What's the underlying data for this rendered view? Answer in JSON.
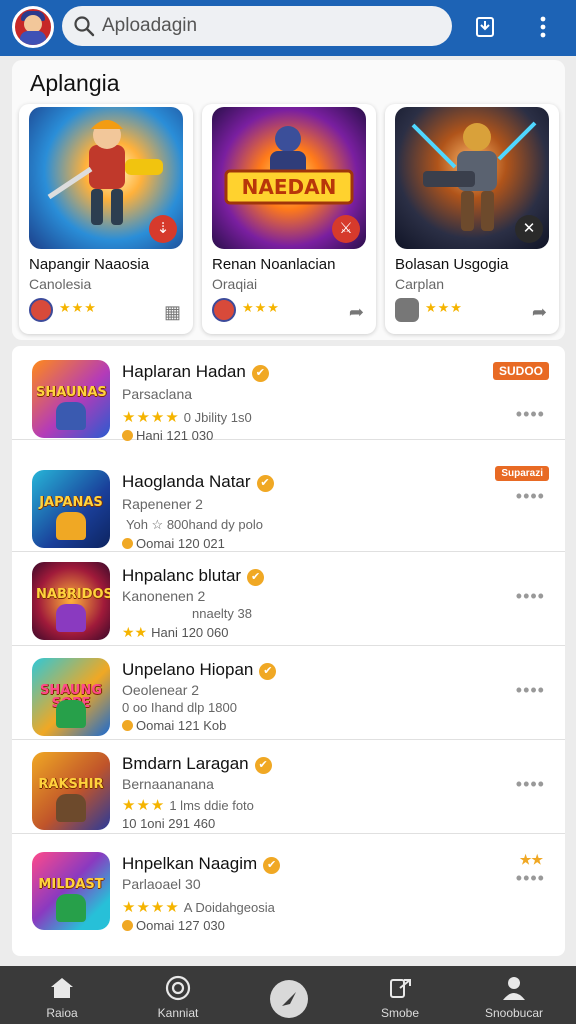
{
  "header": {
    "avatar_icon": "player-avatar-icon",
    "search_placeholder": "Aploadagin",
    "search_icon": "search-icon",
    "history_icon": "download-history-icon",
    "menu_icon": "more-vertical-icon",
    "bg_color": "#1d63b5"
  },
  "featured": {
    "title": "Aplangia",
    "cards": [
      {
        "name": "Napangir Naaosia",
        "subtitle": "Canolesia",
        "stars": "★★★",
        "action_icon": "gift-icon",
        "badge_icon": "download-badge-icon"
      },
      {
        "name": "Renan Noanlacian",
        "subtitle": "Oraqiai",
        "stars": "★★★",
        "action_icon": "share-icon",
        "badge_icon": "controller-badge-icon"
      },
      {
        "name": "Bolasan Usgogia",
        "subtitle": "Carplan",
        "stars": "★★★",
        "action_icon": "share-icon",
        "badge_icon": "close-badge-icon"
      }
    ]
  },
  "list": {
    "items": [
      {
        "name": "Haplaran Hadan",
        "subtitle": "Parsaclana",
        "stars": "★★★★",
        "rating_text": "0 Jbility 1s0",
        "size_text": "Hani 121 030",
        "thumb_title": "SHAUNAS",
        "tag": "SUDOO"
      },
      {
        "name": "Haoglanda Natar",
        "subtitle": "Rapenener 2",
        "stars": "",
        "rating_text": "Yoh ☆ 800hand dy polo",
        "size_text": "Oomai 120 021",
        "thumb_title": "JAPANAS",
        "tag": "Suparazi"
      },
      {
        "name": "Hnpalanc blutar",
        "subtitle": "Kanonenen 2",
        "stars": "★★",
        "rating_text": "nnaelty 38",
        "size_text": "Hani 120 060",
        "thumb_title": "NABRIDOS",
        "tag": ""
      },
      {
        "name": "Unpelano Hiopan",
        "subtitle": "Oeolenear 2",
        "stars": "",
        "rating_text": "0 oo Ihand dlp 1800",
        "size_text": "Oomai 121 Kob",
        "thumb_title": "SHAUNG SOPE",
        "tag": ""
      },
      {
        "name": "Bmdarn Laragan",
        "subtitle": "Bernaananana",
        "stars": "★★★",
        "rating_text": "1 lms ddie foto",
        "size_text": "10 1oni 291 460",
        "thumb_title": "RAKSHIR",
        "tag": ""
      },
      {
        "name": "Hnpelkan Naagim",
        "subtitle": "Parlaoael 30",
        "stars": "★★★★",
        "rating_text": "A Doidahgeosia",
        "size_text": "Oomai 127 030",
        "thumb_title": "MILDAST",
        "tag": "★★"
      }
    ]
  },
  "bottom_nav": {
    "items": [
      {
        "label": "Raioa",
        "icon": "home-icon"
      },
      {
        "label": "Kanniat",
        "icon": "target-icon"
      },
      {
        "label": "",
        "icon": "compass-icon"
      },
      {
        "label": "Smobe",
        "icon": "share-box-icon"
      },
      {
        "label": "Snoobucar",
        "icon": "profile-icon"
      }
    ],
    "bg_color": "#3a3a3a"
  }
}
